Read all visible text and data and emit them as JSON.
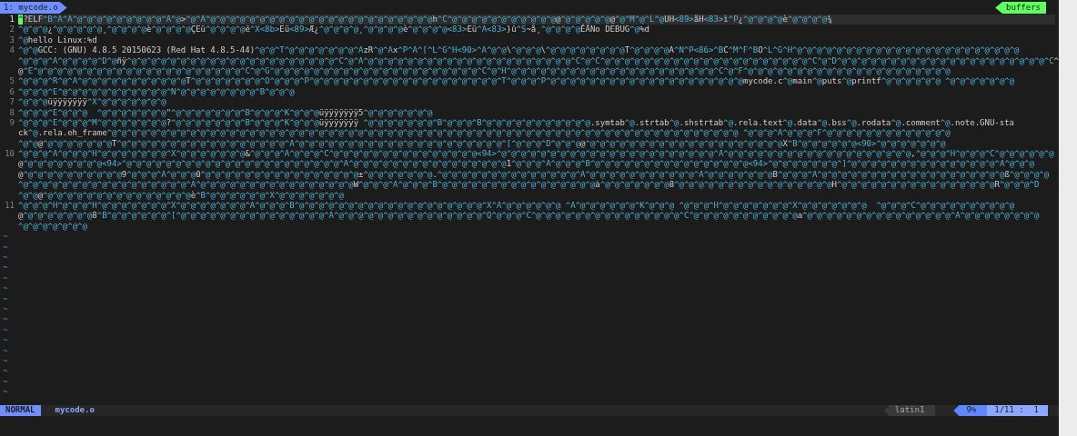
{
  "tabline": {
    "tabs": [
      {
        "label": "1: mycode.o",
        "selected": true
      }
    ],
    "buffers_label": "buffers"
  },
  "buffer": {
    "lines": [
      {
        "number": "1",
        "current": true,
        "cursor": "^",
        "rows": [
          "?ELF^B^A^A^@^@^@^@^@^@^@^@^@^A^@>^@^A^@^@^@^@^@^@^@^@^@^@^@^@^@^@^@^@^@^@^@^@^@^@^@h^C^@^@^@^@^@^@^@^@^@^@^@@^@^@^@^@^@@^@^M^@^L^@UH<89>åH<83>ì^P¿^@^@^@^@è^@^@^@^@¾"
        ]
      },
      {
        "number": "2",
        "current": false,
        "rows": [
          "^@^@^@¿^@^@^@^@^@¸^@^@^@^@è^@^@^@^@ÇEü^@^@^@^@ë^X<8b>Eü<89>Æ¿^@^@^@^@¸^@^@^@^@è^@^@^@^@<83>Eü^A<83>}û^S~å¸^@^@^@^@ÉÃNo DEBUG^@%d"
        ]
      },
      {
        "number": "3",
        "current": false,
        "rows": [
          "^@hello Linux:%d"
        ]
      },
      {
        "number": "4",
        "current": false,
        "rows": [
          "^@^@GCC: (GNU) 4.8.5 20150623 (Red Hat 4.8.5-44)^@^@^T^@^@^@^@^@^@^@^AzR^@^Ax^P^A^[^L^G^H<90>^A^@^@\\^@^@^@\\^@^@^@^@^@^@^@^@T^@^@^@^@A^N^P<86>^BC^M^F^BO^L^G^H^@^@^@^@^@^@^@^@^@^@^@^@^@^@^@^@^@^@^@^@^@^@^@",
          "^@^@^@^A^@^@^@^@^D^@ñÿ^@^@^@^@^@^@^@^@^@^@^@^@^@^@^@^@^@^@^@^@^@^C^@^A^@^@^@^@^@^@^@^@^@^@^@^@^@^@^@^@^@^@^@^@^@^C^@^C^@^@^@^@^@^@^@^@^@^@^@^@^@^@^@^@^@^@^@^@^@^C^@^D^@^@^@^@^@^@^@^@^@^@^@^@^@^@^@^@^@^@^@^@^@^C^",
          "@^E^@^@^@^@^@^@^@^@^@^@^@^@^@^@^@^@^@^@^@^@^@^C^@^G^@^@^@^@^@^@^@^@^@^@^@^@^@^@^@^@^@^@^@^@^@^C^@^H^@^@^@^@^@^@^@^@^@^@^@^@^@^@^@^@^@^@^@^@^@^C^@^F^@^@^@^@^@^@^@^@^@^@^@^@^@^@^@^@^@^@^@^@^@"
        ]
      },
      {
        "number": "5",
        "current": false,
        "rows": [
          "^@^@^@^R^@^A^@^@^@^@^@^@^@^@^@^@^@T^@^@^@^@^@^@^@^O^@^@^@^P^@^@^@^@^@^@^@^@^@^@^@^@^@^@^@^@^@^@^@^T^@^@^@^P^@^@^@^@^@^@^@^@^@^@^@^@^@^@^@^@^@^@^@^@mycode.c^@main^@puts^@printf^@^@^@^@^@^@ ^@^@^@^@^@^@^@"
        ]
      },
      {
        "number": "6",
        "current": false,
        "rows": [
          "^@^@^@^E^@^@^@^@^@^@^@^@^@^@^@^N^@^@^@^@^@^@^@^@^B^@^@^@"
        ]
      },
      {
        "number": "7",
        "current": false,
        "rows": [
          "^@^@^@üÿÿÿÿÿÿÿ^X^@^@^@^@^@^@^@"
        ]
      },
      {
        "number": "8",
        "current": false,
        "rows": [
          "^@^@^@^E^@^@^@  ^@^@^@^@^@^@^@\"^@^@^@^@^@^@^@^B^@^@^@^K^@^@^@üÿÿÿÿÿÿÿ5^@^@^@^@^@^@^@"
        ]
      },
      {
        "number": "9",
        "current": false,
        "rows": [
          "^@^@^@^E^@^@^@^M^@^@^@^@^@^@^@?^@^@^@^@^@^@^@^B^@^@^@^K^@^@^@üÿÿÿÿÿÿÿ ^@^@^@^@^@^@^@^B^@^@^@^B^@^@^@^@^@^@^@^@^@^@^@.symtab^@.strtab^@.shstrtab^@.rela.text^@.data^@.bss^@.rodata^@.comment^@.note.GNU-sta",
          "ck^@.rela.eh_frame^@^@^@^@^@^@^@^@^@^@^@^@^@^@^@^@^@^@^@^@^@^@^@^@^@^@^@^@^@^@^@^@^@^@^@^@^@^@^@^@^@^@^@^@^@^@^@^@^@^@^@^@^@^@^@^@^@^@^@^@^@^@^@^@ ^@^@^@^A^@^@^@^F^@^@^@^@^@^@^@^@^@^@^@^@^@",
          "^@^@@^@^@^@^@^@^@^@T^@^@^@^@^@^@^@^@^@^@^@^@^@^@^@^@^@^A^@^@^@^@^@^@^@^@^@^@^@^@^@^@^@^@^@^@^@^@^@^[^@^@^@^D^@^@^@@^@^@^@^@^@^@^@^@^@^@^@^@^@^@^@^@^@^@^@^@X^B^@^@^@^@^@^@<90>^@^@^@^@^@^@^@"
        ]
      },
      {
        "number": "10",
        "current": false,
        "rows": [
          "^@^@^@^A^@^@^@^H^@^@^@^@^@^@^@^X^@^@^@^@^@^@^@&^@^@^@^A^@^@^@^C^@^@^@^@^@^@^@^@^@^@^@^@^@^@^@<94>^@^@^@^@^@^@^@^@^@^@^@^@^@^@^@^@^@^@^@^@^@^@^A^@^@^@^@^@^@^@^@^@^@^@^@^@^@^@^@^@^@^@,^@^@^@^H^@^@^@^C^@^@^@^@^@^@",
          "@^@^@^@^@^@^@^@^@<94>^@^@^@^@^@^@^@^@^@^@^@^@^@^@^@^@^@^@^@^@^@^@^A^@^@^@^@^@^@^@^@^@^@^@^@^@^@^@^@1^@^@^@^A^@^@^@^B^@^@^@^@^@^@^@^@^@^@^@^@^@^@^@^@<94>^@^@^@^@^@^@^@^]^@^@^@^@^@^@^@^@^@^@^@^@^@^@^@^A^@^@^@",
          "@^@^@^@^@^@^@^@^@^@^@9^@^@^@^A^@^@^@0^@^@^@^@^@^@^@^@^@^@^@^@^@^@^@^@±^@^@^@^@^@^@^@.^@^@^@^@^@^@^@^@^@^@^@^@^@^@^A^@^@^@^@^@^@^@^@^@^@^@^A^@^@^@^@^@^@^@B^@^@^@^A^@^@^@^@^@^@^@^@^@^@^@^@^@^@^@^@^@^@^@ß^@^@^@^@",
          "^@^@^@^@^@^@^@^@^@^@^@^@^@^@^@^@^@^A^@^@^@^@^@^@^@^@^@^@^@^@^@^@^@^@W^@^@^@^A^@^@^@^B^@^@^@^@^@^@^@^@^@^@^@^@^@^@^@^@à^@^@^@^@^@^@^@8^@^@^@^@^@^@^@^@^@^@^@^@^@^@^@^@H^@^@^@^@^@^@^@^@^@^@^@^@^@^@^@^@R^@^@^@^D",
          "^@^@@^@^@^@^@^@^@^@^@^@^@^@^@^@^@^@è^B^@^@^@^@^@^@^X^@^@^@^@^@^@^@"
        ]
      },
      {
        "number": "11",
        "current": false,
        "rows": [
          "^@^@^@^H^@^@^@^H^@^@^@^@^@^@^@^X^@^@^@^@^@^@^@^A^@^@^@^B^@^@^@^@^@^@^@^@^@^@^@^@^@^@^@^@^@^@^@^X^A^@^@^@^@^@^@ ^A^@^@^@^@^@^@^K^@^@^@ ^@^@^@^H^@^@^@^@^@^@^@^X^@^@^@^@^@^@^@  ^@^@^@^C^@^@^@^@^@^@^@^@^@^@",
          "@^@^@^@^@^@^@^@8^B^@^@^@^@^@^@^[^@^@^@^@^@^@^@^@^@^@^@^@^@^@^@^A^@^@^@^@^@^@^@^@^@^@^@^@^@^@^@^Q^@^@^@^C^@^@^@^@^@^@^@^@^@^@^@^@^@^@^@^C^@^@^@^@^@^@^@^@^@^@^@a^@^@^@^@^@^@^@^@^@^@^@^@^@^@^@^A^@^@^@^@^@^@^@^@",
          "^@^@^@^@^@^@^@"
        ]
      }
    ],
    "filler": [
      "~",
      "~",
      "~",
      "~",
      "~",
      "~",
      "~",
      "~",
      "~",
      "~",
      "~",
      "~",
      "~",
      "~",
      "~",
      "~"
    ]
  },
  "status_bar": {
    "mode": "NORMAL",
    "file": "mycode.o",
    "encoding": "latin1",
    "percent": "9%",
    "position": "1/11 :  1"
  }
}
